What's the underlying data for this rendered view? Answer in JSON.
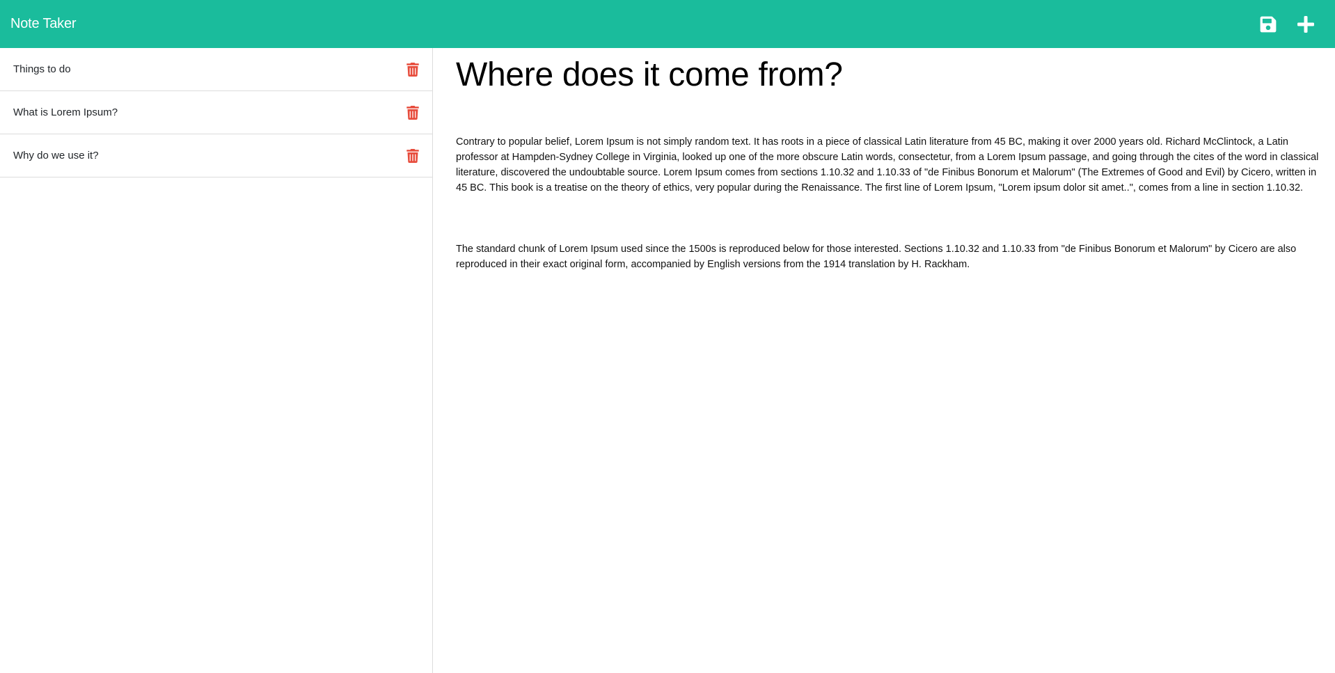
{
  "navbar": {
    "brand": "Note Taker",
    "save_icon": "floppy-disk-save-icon",
    "new_icon": "plus-new-note-icon",
    "background": "#1abc9c"
  },
  "sidebar": {
    "notes": [
      {
        "title": "Things to do",
        "delete_icon": "trash-icon"
      },
      {
        "title": "What is Lorem Ipsum?",
        "delete_icon": "trash-icon"
      },
      {
        "title": "Why do we use it?",
        "delete_icon": "trash-icon"
      }
    ],
    "delete_color": "#e74c3c"
  },
  "editor": {
    "title": "Where does it come from?",
    "paragraphs": [
      "Contrary to popular belief, Lorem Ipsum is not simply random text. It has roots in a piece of classical Latin literature from 45 BC, making it over 2000 years old. Richard McClintock, a Latin professor at Hampden-Sydney College in Virginia, looked up one of the more obscure Latin words, consectetur, from a Lorem Ipsum passage, and going through the cites of the word in classical literature, discovered the undoubtable source. Lorem Ipsum comes from sections 1.10.32 and 1.10.33 of \"de Finibus Bonorum et Malorum\" (The Extremes of Good and Evil) by Cicero, written in 45 BC. This book is a treatise on the theory of ethics, very popular during the Renaissance. The first line of Lorem Ipsum, \"Lorem ipsum dolor sit amet..\", comes from a line in section 1.10.32.",
      "The standard chunk of Lorem Ipsum used since the 1500s is reproduced below for those interested. Sections 1.10.32 and 1.10.33 from \"de Finibus Bonorum et Malorum\" by Cicero are also reproduced in their exact original form, accompanied by English versions from the 1914 translation by H. Rackham."
    ]
  }
}
